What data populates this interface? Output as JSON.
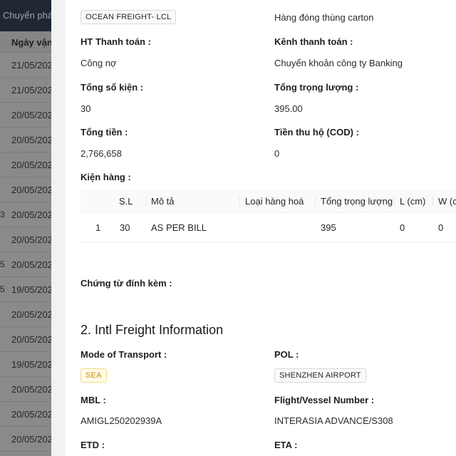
{
  "background_list": {
    "header_label": "Chuyển phá",
    "column_header": "Ngày vận",
    "rows": [
      {
        "date": "21/05/202",
        "edge": ""
      },
      {
        "date": "21/05/202",
        "edge": ""
      },
      {
        "date": "20/05/202",
        "edge": ""
      },
      {
        "date": "20/05/202",
        "edge": ""
      },
      {
        "date": "20/05/202",
        "edge": ""
      },
      {
        "date": "20/05/202",
        "edge": ""
      },
      {
        "date": "20/05/202",
        "edge": "3"
      },
      {
        "date": "20/05/202",
        "edge": ""
      },
      {
        "date": "20/05/202",
        "edge": "5"
      },
      {
        "date": "19/05/202",
        "edge": "5"
      },
      {
        "date": "20/05/202",
        "edge": ""
      },
      {
        "date": "20/05/202",
        "edge": ""
      },
      {
        "date": "19/05/202",
        "edge": ""
      },
      {
        "date": "20/05/202",
        "edge": ""
      },
      {
        "date": "20/05/202",
        "edge": ""
      },
      {
        "date": "20/05/202",
        "edge": ""
      }
    ]
  },
  "details": {
    "service_tag": "OCEAN FREIGHT- LCL",
    "packaging_value": "Hàng đóng thùng carton",
    "payment_method_label": "HT Thanh toán :",
    "payment_method_value": "Công nợ",
    "payment_channel_label": "Kênh thanh toán :",
    "payment_channel_value": "Chuyển khoản công ty Banking",
    "total_packages_label": "Tổng số kiện :",
    "total_packages_value": "30",
    "total_weight_label": "Tổng trọng lượng :",
    "total_weight_value": "395.00",
    "total_amount_label": "Tổng tiền :",
    "total_amount_value": "2,766,658",
    "cod_label": "Tiền thu hộ (COD) :",
    "cod_value": "0",
    "cargo_label": "Kiện hàng :"
  },
  "cargo_table": {
    "headers": {
      "qty": "S.L",
      "description": "Mô tả",
      "goods_type": "Loại hàng hoá",
      "weight": "Tổng trọng lượng",
      "length": "L (cm)",
      "width": "W (c"
    },
    "rows": [
      {
        "index": "1",
        "qty": "30",
        "description": "AS PER BILL",
        "goods_type": "",
        "weight": "395",
        "length": "0",
        "width": "0"
      }
    ]
  },
  "attachments_label": "Chứng từ đính kèm :",
  "intl_freight": {
    "title": "2. Intl Freight Information",
    "mode_label": "Mode of Transport :",
    "mode_value": "SEA",
    "pol_label": "POL :",
    "pol_value": "SHENZHEN AIRPORT",
    "mbl_label": "MBL :",
    "mbl_value": "AMIGL250202939A",
    "vessel_label": "Flight/Vessel Number :",
    "vessel_value": "INTERASIA ADVANCE/S308",
    "etd_label": "ETD :",
    "eta_label": "ETA :"
  }
}
